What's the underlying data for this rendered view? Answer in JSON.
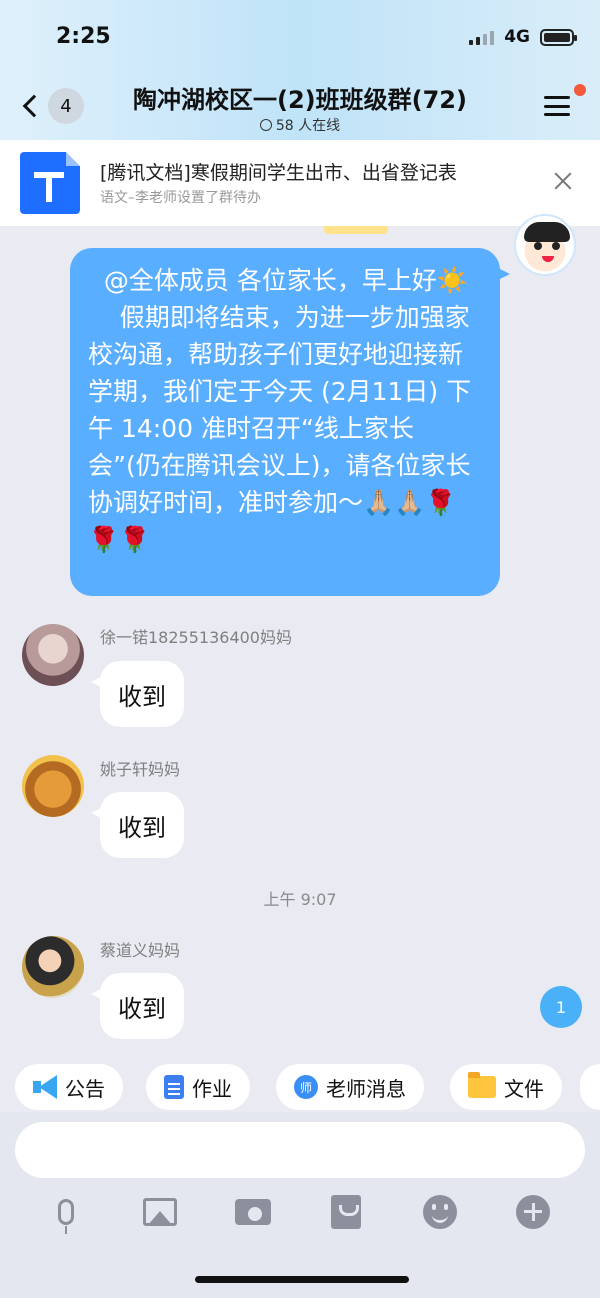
{
  "status_bar": {
    "time": "2:25",
    "network": "4G"
  },
  "header": {
    "back_count": "4",
    "title": "陶冲湖校区一(2)班班级群(72)",
    "online": "58 人在线"
  },
  "todo_banner": {
    "title": "[腾讯文档]寒假期间学生出市、出省登记表",
    "subtitle": "语文–李老师设置了群待办"
  },
  "messages": {
    "teacher": {
      "text": "  @全体成员 各位家长，早上好☀️\n    假期即将结束，为进一步加强家校沟通，帮助孩子们更好地迎接新学期，我们定于今天 (2月11日) 下午 14:00 准时召开“线上家长会”(仍在腾讯会议上)，请各位家长协调好时间，准时参加～🙏🏼🙏🏼🌹🌹🌹"
    },
    "items": [
      {
        "sender": "徐一锘18255136400妈妈",
        "text": "收到"
      },
      {
        "sender": "姚子轩妈妈",
        "text": "收到"
      },
      {
        "sender": "蔡道义妈妈",
        "text": "收到"
      }
    ],
    "timestamp": "上午 9:07",
    "unread_badge": "1"
  },
  "shortcuts": [
    {
      "label": "公告",
      "icon": "megaphone-icon"
    },
    {
      "label": "作业",
      "icon": "document-icon"
    },
    {
      "label": "老师消息",
      "icon": "teacher-icon"
    },
    {
      "label": "文件",
      "icon": "folder-icon"
    }
  ],
  "shortcut_teacher_glyph": "师",
  "toolbar": {
    "icons": [
      "microphone-icon",
      "image-icon",
      "camera-icon",
      "red-packet-icon",
      "emoji-icon",
      "plus-icon"
    ]
  },
  "colors": {
    "accent_blue": "#5aaeff",
    "header_gradient": "#bfe3f8",
    "notification_dot": "#f35a3a"
  }
}
